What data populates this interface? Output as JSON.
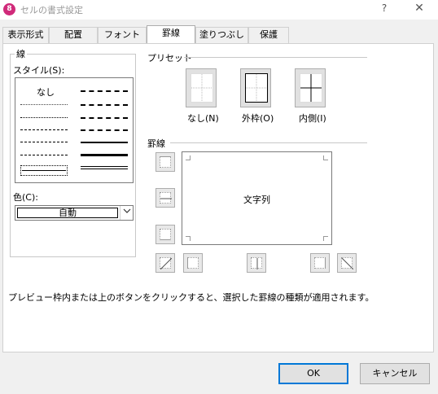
{
  "window": {
    "title": "セルの書式設定",
    "help_label": "?",
    "close_label": "✕",
    "icon_label": "8"
  },
  "tabs": [
    {
      "label": "表示形式"
    },
    {
      "label": "配置"
    },
    {
      "label": "フォント"
    },
    {
      "label": "罫線",
      "active": true
    },
    {
      "label": "塗りつぶし"
    },
    {
      "label": "保護"
    }
  ],
  "line_group": {
    "title": "線",
    "style_label": "スタイル(S):",
    "none_label": "なし",
    "color_label": "色(C):",
    "color_value": "自動",
    "dropdown_icon": "chevron-down-icon"
  },
  "presets": {
    "title": "プリセット",
    "items": [
      {
        "label": "なし(N)"
      },
      {
        "label": "外枠(O)"
      },
      {
        "label": "内側(I)"
      }
    ]
  },
  "border": {
    "title": "罫線",
    "preview_text": "文字列"
  },
  "info": "プレビュー枠内または上のボタンをクリックすると、選択した罫線の種類が適用されます。",
  "buttons": {
    "ok": "OK",
    "cancel": "キャンセル"
  },
  "colors": {
    "accent": "#0078d7",
    "icon": "#d02a7a"
  }
}
